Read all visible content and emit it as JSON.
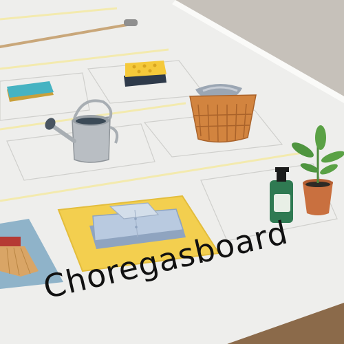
{
  "caption": "Choregasboard",
  "colors": {
    "board": "#eeeeec",
    "board_edge": "#f7f7f5",
    "wall": "#cfcbc5",
    "floor": "#8b6a4a",
    "highlight_tile": "#f3cf4f",
    "blue_tile": "#8fb3c9",
    "text": "#111111"
  },
  "objects": [
    {
      "name": "mop-handle",
      "label": ""
    },
    {
      "name": "scrub-sponge",
      "label": ""
    },
    {
      "name": "yellow-sponge",
      "label": ""
    },
    {
      "name": "watering-can",
      "label": ""
    },
    {
      "name": "laundry-basket",
      "label": ""
    },
    {
      "name": "folded-shirt",
      "label": ""
    },
    {
      "name": "soap-bottle",
      "label": ""
    },
    {
      "name": "potted-plant",
      "label": ""
    },
    {
      "name": "broom",
      "label": ""
    }
  ]
}
